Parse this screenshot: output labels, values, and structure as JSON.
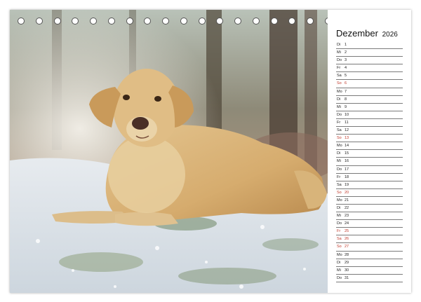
{
  "calendar": {
    "month": "Dezember",
    "year": "2026",
    "days": [
      {
        "dn": "Di",
        "nr": "1",
        "red": false
      },
      {
        "dn": "Mi",
        "nr": "2",
        "red": false
      },
      {
        "dn": "Do",
        "nr": "3",
        "red": false
      },
      {
        "dn": "Fr",
        "nr": "4",
        "red": false
      },
      {
        "dn": "Sa",
        "nr": "5",
        "red": false
      },
      {
        "dn": "So",
        "nr": "6",
        "red": true
      },
      {
        "dn": "Mo",
        "nr": "7",
        "red": false
      },
      {
        "dn": "Di",
        "nr": "8",
        "red": false
      },
      {
        "dn": "Mi",
        "nr": "9",
        "red": false
      },
      {
        "dn": "Do",
        "nr": "10",
        "red": false
      },
      {
        "dn": "Fr",
        "nr": "11",
        "red": false
      },
      {
        "dn": "Sa",
        "nr": "12",
        "red": false
      },
      {
        "dn": "So",
        "nr": "13",
        "red": true
      },
      {
        "dn": "Mo",
        "nr": "14",
        "red": false
      },
      {
        "dn": "Di",
        "nr": "15",
        "red": false
      },
      {
        "dn": "Mi",
        "nr": "16",
        "red": false
      },
      {
        "dn": "Do",
        "nr": "17",
        "red": false
      },
      {
        "dn": "Fr",
        "nr": "18",
        "red": false
      },
      {
        "dn": "Sa",
        "nr": "19",
        "red": false
      },
      {
        "dn": "So",
        "nr": "20",
        "red": true
      },
      {
        "dn": "Mo",
        "nr": "21",
        "red": false
      },
      {
        "dn": "Di",
        "nr": "22",
        "red": false
      },
      {
        "dn": "Mi",
        "nr": "23",
        "red": false
      },
      {
        "dn": "Do",
        "nr": "24",
        "red": false
      },
      {
        "dn": "Fr",
        "nr": "25",
        "red": true
      },
      {
        "dn": "Sa",
        "nr": "26",
        "red": true
      },
      {
        "dn": "So",
        "nr": "27",
        "red": true
      },
      {
        "dn": "Mo",
        "nr": "28",
        "red": false
      },
      {
        "dn": "Di",
        "nr": "29",
        "red": false
      },
      {
        "dn": "Mi",
        "nr": "30",
        "red": false
      },
      {
        "dn": "Do",
        "nr": "31",
        "red": false
      }
    ]
  },
  "binding": {
    "ring_count": 22
  },
  "colors": {
    "holiday": "#c0392b",
    "line": "#7a7a7a"
  }
}
